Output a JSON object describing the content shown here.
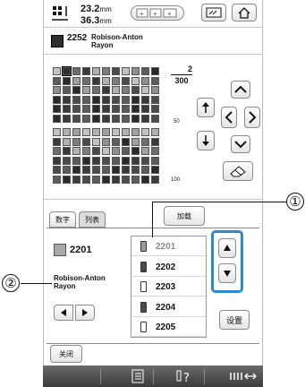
{
  "header": {
    "width_value": "23.2",
    "height_value": "36.3",
    "unit": "mm"
  },
  "thread": {
    "number": "2252",
    "brand_line1": "Robison-Anton",
    "brand_line2": "Rayon"
  },
  "palette": {
    "page_current": "2",
    "page_total": "300",
    "scale_50": "50",
    "scale_100": "100"
  },
  "tabs": {
    "numeric": "数字",
    "list": "列表",
    "load": "加载"
  },
  "selected": {
    "code": "2201",
    "brand_line1": "Robison-Anton",
    "brand_line2": "Rayon"
  },
  "thread_list": {
    "items": [
      {
        "code": "2201",
        "dim": true
      },
      {
        "code": "2202",
        "dim": false
      },
      {
        "code": "2203",
        "dim": false
      },
      {
        "code": "2204",
        "dim": false
      },
      {
        "code": "2205",
        "dim": false
      }
    ]
  },
  "buttons": {
    "set": "设置",
    "close": "关闭"
  },
  "callouts": {
    "one": "①",
    "two": "②"
  },
  "colors": {
    "highlight": "#2a8ad6",
    "bar": "#4a4a4a"
  }
}
